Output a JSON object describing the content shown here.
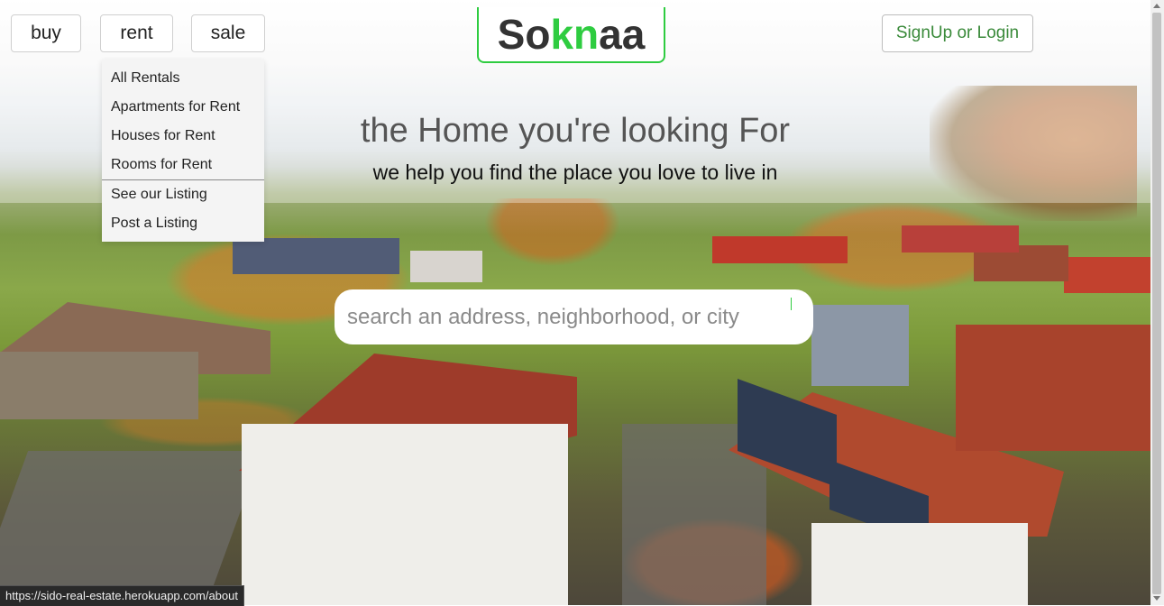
{
  "nav": {
    "buy_label": "buy",
    "rent_label": "rent",
    "sale_label": "sale"
  },
  "logo": {
    "prefix": "So",
    "accent": "kn",
    "suffix": "aa"
  },
  "auth": {
    "label": "SignUp or Login"
  },
  "rent_menu": {
    "items": [
      "All Rentals",
      "Apartments for Rent",
      "Houses for Rent",
      "Rooms for Rent",
      "See our Listing",
      "Post a Listing"
    ]
  },
  "hero": {
    "title": "the Home you're looking For",
    "subtitle": "we help you find the place you love to live in"
  },
  "search": {
    "placeholder": "search an address, neighborhood, or city",
    "value": ""
  },
  "status_bar": {
    "url": "https://sido-real-estate.herokuapp.com/about"
  },
  "colors": {
    "brand_green": "#2ecc40",
    "login_text": "#3a8a3a"
  }
}
